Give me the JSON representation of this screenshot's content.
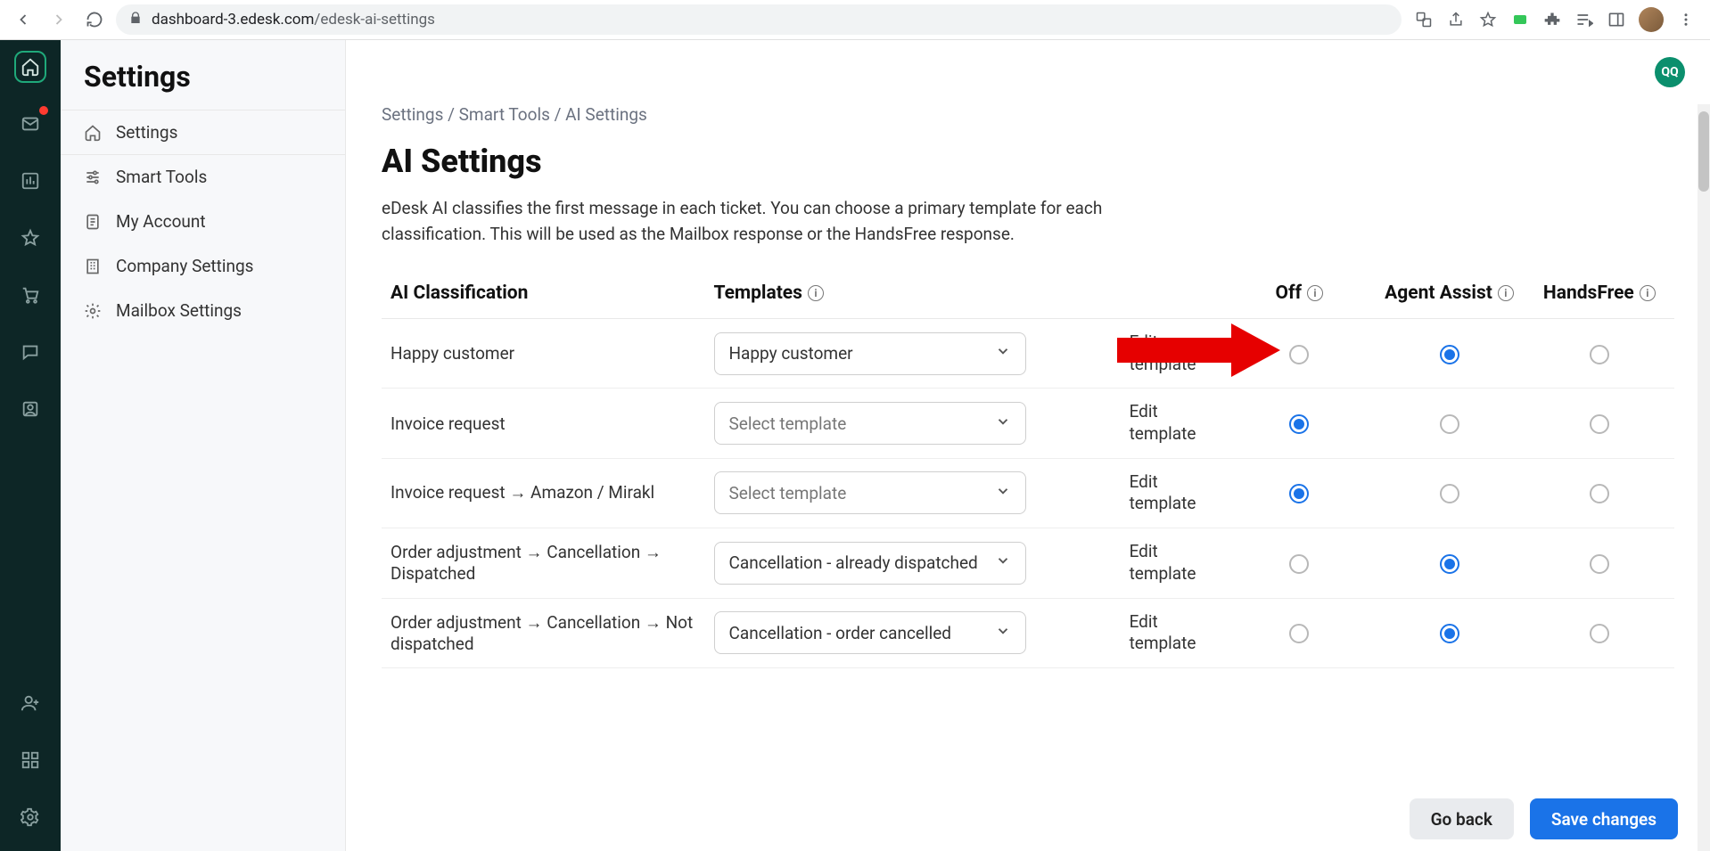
{
  "browser": {
    "url_host": "dashboard-3.edesk.com",
    "url_path": "/edesk-ai-settings"
  },
  "rail": {
    "items": [
      "home",
      "mail",
      "chart",
      "star",
      "cart",
      "chat",
      "badge"
    ],
    "bottom": [
      "user-plus",
      "apps",
      "gear"
    ]
  },
  "sidebar": {
    "title": "Settings",
    "items": [
      {
        "label": "Settings",
        "icon": "home"
      },
      {
        "label": "Smart Tools",
        "icon": "sliders"
      },
      {
        "label": "My Account",
        "icon": "id"
      },
      {
        "label": "Company Settings",
        "icon": "building"
      },
      {
        "label": "Mailbox Settings",
        "icon": "gear"
      }
    ]
  },
  "user_badge": "QQ",
  "breadcrumb": "Settings / Smart Tools / AI Settings",
  "page": {
    "title": "AI Settings",
    "desc": "eDesk AI classifies the first message in each ticket. You can choose a primary template for each classification. This will be used as the Mailbox response or the HandsFree response."
  },
  "table": {
    "headers": {
      "classification": "AI Classification",
      "templates": "Templates",
      "off": "Off",
      "agent": "Agent Assist",
      "hands": "HandsFree"
    },
    "edit_label": "Edit template",
    "select_placeholder": "Select template",
    "rows": [
      {
        "classification": "Happy customer",
        "template": "Happy customer",
        "has_template": true,
        "selected": "agent"
      },
      {
        "classification": "Invoice request",
        "template": "",
        "has_template": false,
        "selected": "off"
      },
      {
        "classification": "Invoice request → Amazon / Mirakl",
        "template": "",
        "has_template": false,
        "selected": "off"
      },
      {
        "classification": "Order adjustment → Cancellation → Dispatched",
        "template": "Cancellation - already dispatched",
        "has_template": true,
        "selected": "agent"
      },
      {
        "classification": "Order adjustment → Cancellation → Not dispatched",
        "template": "Cancellation - order cancelled",
        "has_template": true,
        "selected": "agent"
      }
    ]
  },
  "footer": {
    "back": "Go back",
    "save": "Save changes"
  }
}
